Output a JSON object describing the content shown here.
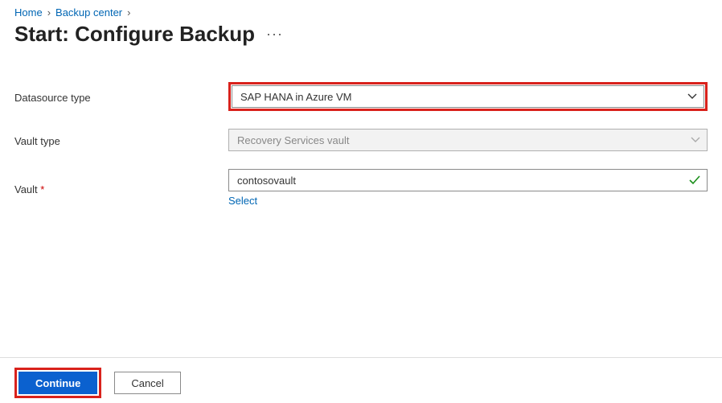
{
  "breadcrumb": {
    "home": "Home",
    "backup_center": "Backup center"
  },
  "page": {
    "title": "Start: Configure Backup",
    "ellipsis": "···"
  },
  "form": {
    "datasource_type": {
      "label": "Datasource type",
      "value": "SAP HANA in Azure VM"
    },
    "vault_type": {
      "label": "Vault type",
      "value": "Recovery Services vault"
    },
    "vault": {
      "label": "Vault",
      "value": "contosovault",
      "select_link": "Select"
    }
  },
  "footer": {
    "continue": "Continue",
    "cancel": "Cancel"
  }
}
